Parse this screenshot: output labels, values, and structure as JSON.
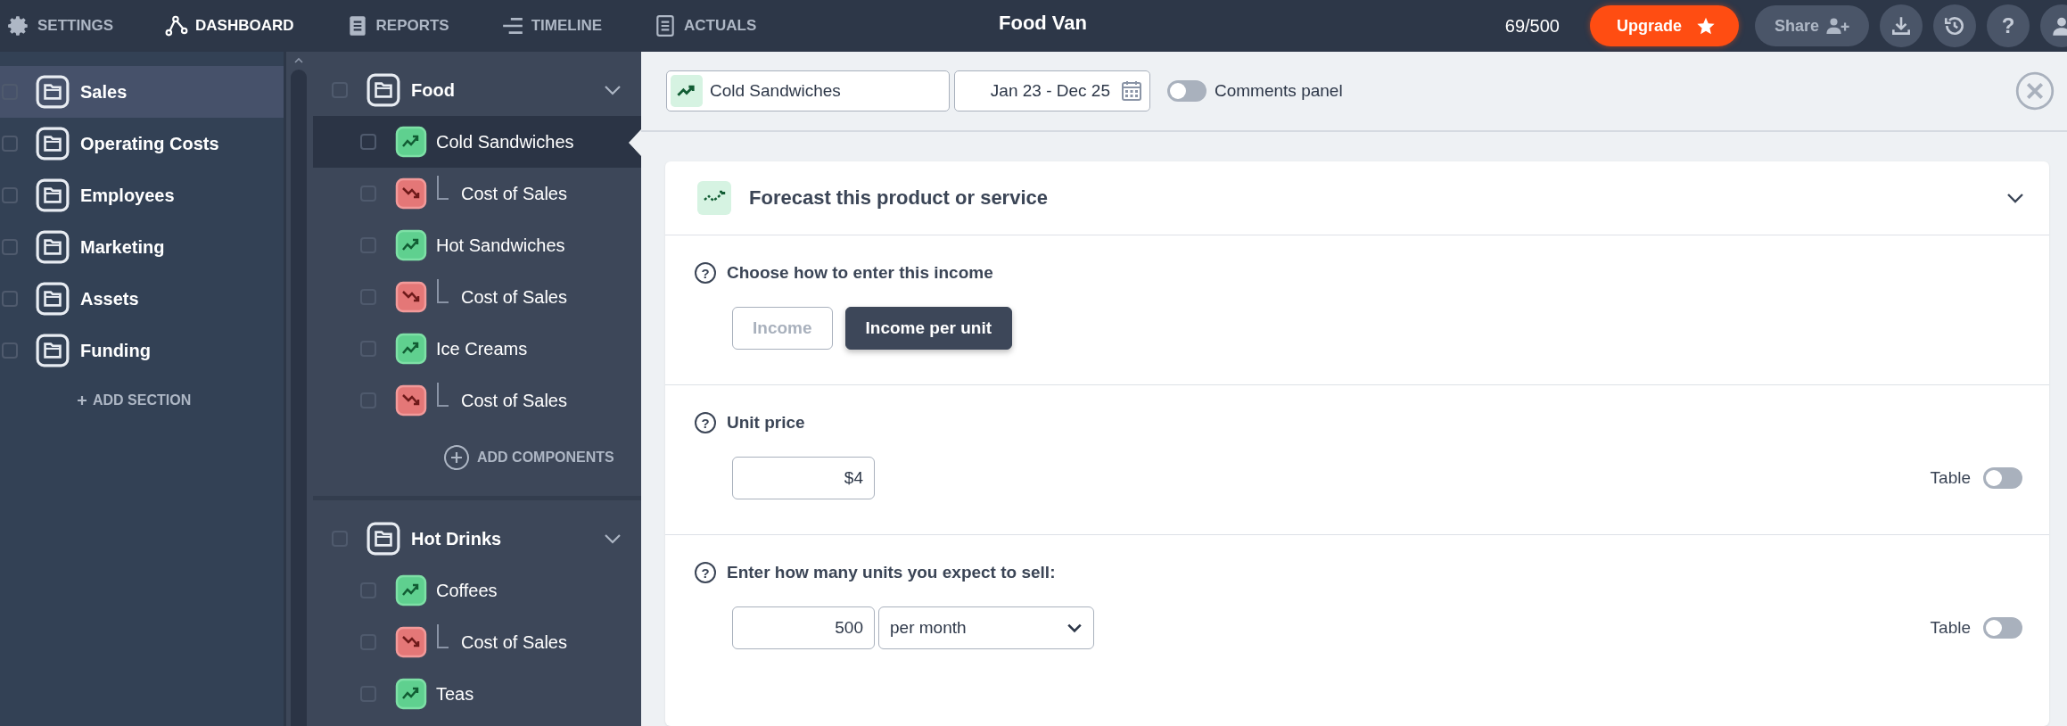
{
  "nav": [
    {
      "label": "SETTINGS",
      "selected": false
    },
    {
      "label": "DASHBOARD",
      "selected": true
    },
    {
      "label": "REPORTS",
      "selected": false
    },
    {
      "label": "TIMELINE",
      "selected": false
    },
    {
      "label": "ACTUALS",
      "selected": false
    }
  ],
  "title": "Food Van",
  "usage": "69/500",
  "upgrade": "Upgrade",
  "share": "Share",
  "help": "?",
  "sections": [
    {
      "label": "Sales",
      "selected": true,
      "checked": false
    },
    {
      "label": "Operating Costs",
      "selected": false,
      "checked": false
    },
    {
      "label": "Employees",
      "selected": false,
      "checked": false
    },
    {
      "label": "Marketing",
      "selected": false,
      "checked": false
    },
    {
      "label": "Assets",
      "selected": false,
      "checked": false
    },
    {
      "label": "Funding",
      "selected": false,
      "checked": false
    }
  ],
  "add_section": "ADD SECTION",
  "groups": [
    {
      "label": "Food",
      "expanded": true,
      "checked": false,
      "add": "ADD COMPONENTS",
      "items": [
        {
          "kind": "income",
          "label": "Cold Sandwiches",
          "selected": true,
          "checked": false
        },
        {
          "kind": "cost",
          "label": "Cost of Sales",
          "selected": false,
          "checked": false
        },
        {
          "kind": "income",
          "label": "Hot Sandwiches",
          "selected": false,
          "checked": false
        },
        {
          "kind": "cost",
          "label": "Cost of Sales",
          "selected": false,
          "checked": false
        },
        {
          "kind": "income",
          "label": "Ice Creams",
          "selected": false,
          "checked": false
        },
        {
          "kind": "cost",
          "label": "Cost of Sales",
          "selected": false,
          "checked": false
        }
      ]
    },
    {
      "label": "Hot Drinks",
      "expanded": true,
      "checked": false,
      "items": [
        {
          "kind": "income",
          "label": "Coffees",
          "selected": false,
          "checked": false
        },
        {
          "kind": "cost",
          "label": "Cost of Sales",
          "selected": false,
          "checked": false
        },
        {
          "kind": "income",
          "label": "Teas",
          "selected": false,
          "checked": false
        }
      ]
    }
  ],
  "toolbar": {
    "component": "Cold Sandwiches",
    "dates": "Jan 23 - Dec 25",
    "comments": {
      "label": "Comments panel",
      "on": false
    }
  },
  "card": {
    "title": "Forecast this product or service",
    "expanded": true,
    "method": {
      "hint": "?",
      "label": "Choose how to enter this income",
      "options": [
        {
          "label": "Income",
          "selected": false
        },
        {
          "label": "Income per unit",
          "selected": true
        }
      ]
    },
    "unit_price": {
      "hint": "?",
      "label": "Unit price",
      "value": "$4",
      "table": {
        "label": "Table",
        "on": false
      }
    },
    "units": {
      "hint": "?",
      "label": "Enter how many units you expect to sell:",
      "value": "500",
      "period": "per month",
      "table": {
        "label": "Table",
        "on": false
      }
    }
  }
}
